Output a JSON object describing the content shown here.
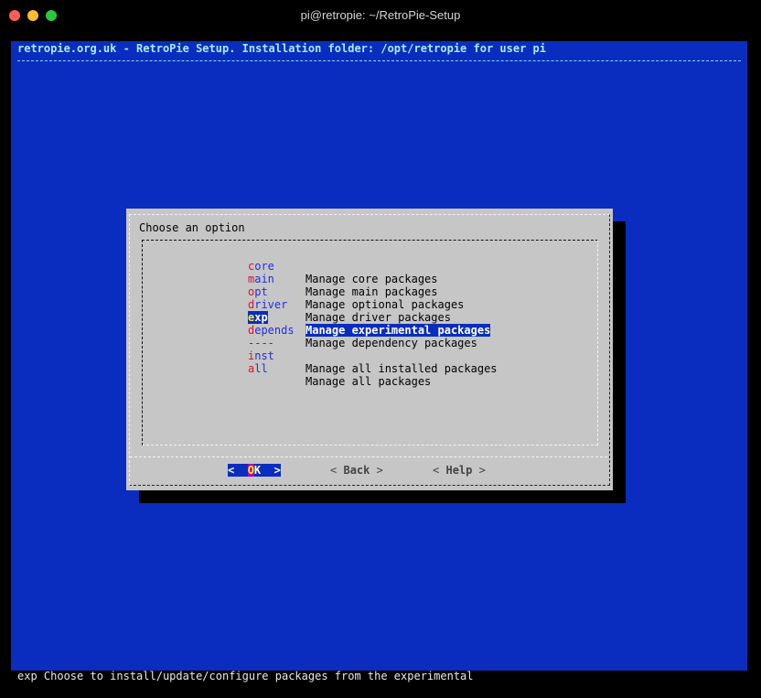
{
  "window": {
    "title": "pi@retropie: ~/RetroPie-Setup"
  },
  "terminal": {
    "backtitle": "retropie.org.uk - RetroPie Setup. Installation folder: /opt/retropie for user pi",
    "background": "#0a2dbf"
  },
  "dialog": {
    "prompt": "Choose an option",
    "menu": [
      {
        "hot": "c",
        "rest": "ore",
        "desc": "Manage core packages"
      },
      {
        "hot": "m",
        "rest": "ain",
        "desc": "Manage main packages"
      },
      {
        "hot": "o",
        "rest": "pt",
        "desc": "Manage optional packages"
      },
      {
        "hot": "d",
        "rest": "river",
        "desc": "Manage driver packages"
      },
      {
        "hot": "e",
        "rest": "xp",
        "desc": "Manage experimental packages",
        "selected": true
      },
      {
        "hot": "d",
        "rest": "epends",
        "desc": "Manage dependency packages"
      },
      {
        "hot": "",
        "rest": "----",
        "desc": "",
        "separator": true
      },
      {
        "hot": "i",
        "rest": "nst",
        "desc": "Manage all installed packages"
      },
      {
        "hot": "a",
        "rest": "ll",
        "desc": "Manage all packages"
      }
    ],
    "buttons": {
      "ok": {
        "left": "<  ",
        "hot": "O",
        "rest": "K",
        "right": "  >"
      },
      "back": {
        "left": "< ",
        "hot": "B",
        "rest": "ack",
        "right": " >"
      },
      "help": {
        "left": "< ",
        "hot": "H",
        "rest": "elp",
        "right": " >"
      }
    }
  },
  "status": {
    "text": "exp Choose to install/update/configure packages from the experimental"
  },
  "colors": {
    "close": "#ff5f57",
    "minimize": "#febc2e",
    "zoom": "#28c840",
    "selection": "#0a2dbf",
    "hotkey": "#e0122a",
    "tag": "#1e2ee6"
  }
}
